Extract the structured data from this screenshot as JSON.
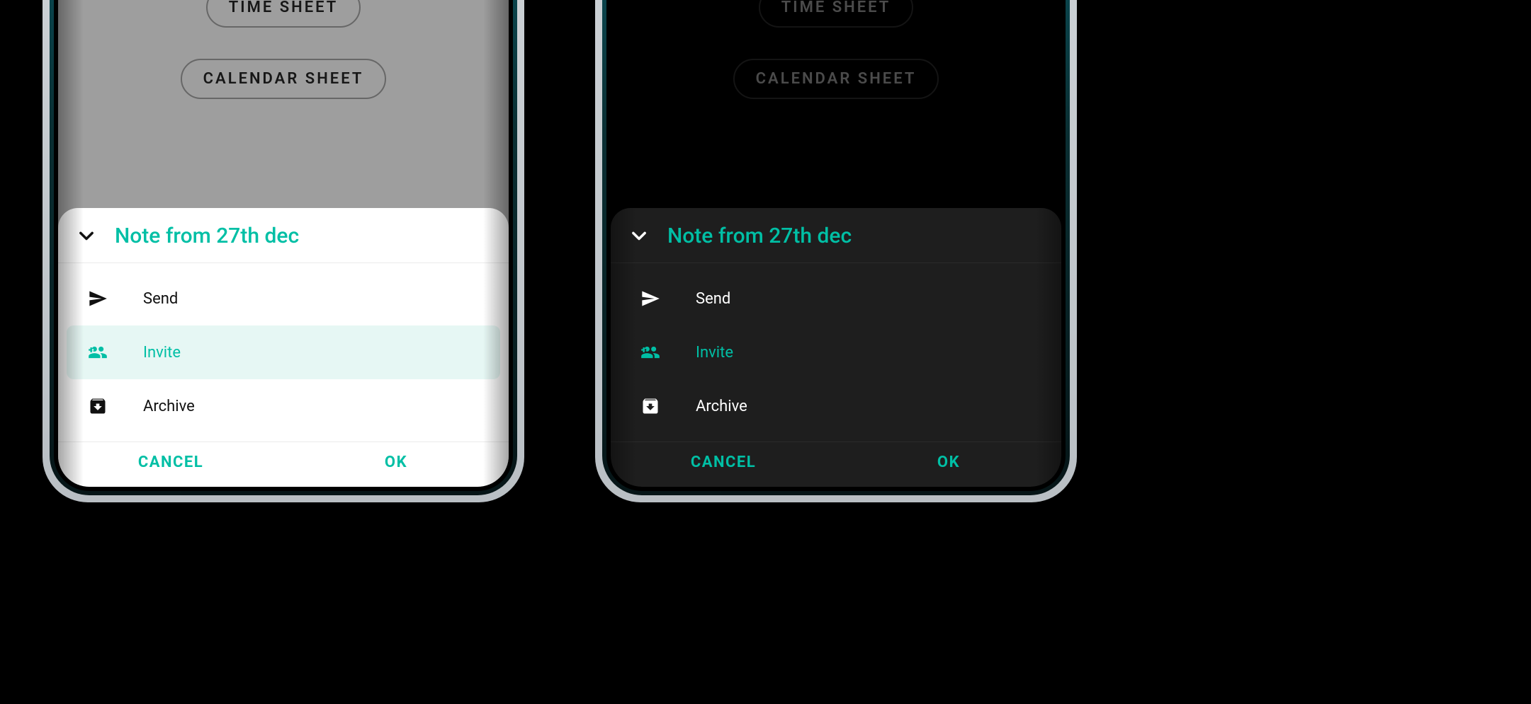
{
  "accent_color": "#00BFA5",
  "background": {
    "chips": [
      {
        "id": "time-sheet",
        "label": "TIME SHEET"
      },
      {
        "id": "calendar-sheet",
        "label": "CALENDAR SHEET"
      }
    ]
  },
  "sheet": {
    "title": "Note from 27th dec",
    "items": [
      {
        "id": "send",
        "label": "Send",
        "icon": "send-icon",
        "selected": false
      },
      {
        "id": "invite",
        "label": "Invite",
        "icon": "invite-icon",
        "selected": true
      },
      {
        "id": "archive",
        "label": "Archive",
        "icon": "archive-icon",
        "selected": false
      }
    ],
    "actions": {
      "cancel": "CANCEL",
      "ok": "OK"
    }
  },
  "variants": [
    "light",
    "dark"
  ]
}
